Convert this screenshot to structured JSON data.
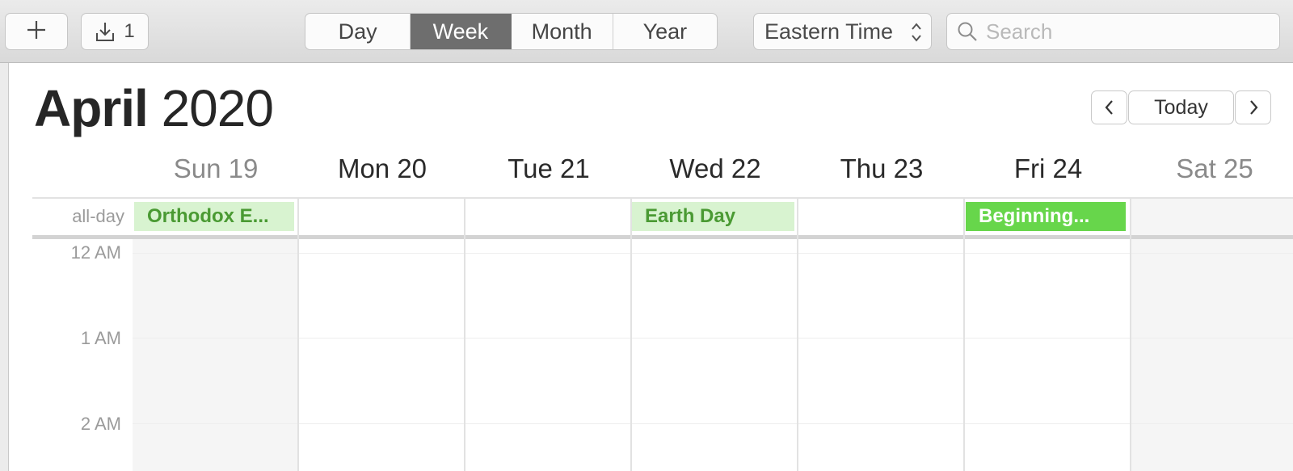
{
  "toolbar": {
    "add_icon": "plus-icon",
    "import_icon": "download-tray-icon",
    "import_count": "1",
    "view_tabs": [
      {
        "label": "Day",
        "active": false
      },
      {
        "label": "Week",
        "active": true
      },
      {
        "label": "Month",
        "active": false
      },
      {
        "label": "Year",
        "active": false
      }
    ],
    "timezone": "Eastern Time",
    "search_placeholder": "Search"
  },
  "header": {
    "month": "April",
    "year": "2020",
    "prev_icon": "chevron-left-icon",
    "today_label": "Today",
    "next_icon": "chevron-right-icon"
  },
  "days": [
    {
      "label": "Sun 19",
      "weekend": true
    },
    {
      "label": "Mon 20",
      "weekend": false
    },
    {
      "label": "Tue 21",
      "weekend": false
    },
    {
      "label": "Wed 22",
      "weekend": false
    },
    {
      "label": "Thu 23",
      "weekend": false
    },
    {
      "label": "Fri 24",
      "weekend": false
    },
    {
      "label": "Sat 25",
      "weekend": true
    }
  ],
  "all_day": {
    "label": "all-day",
    "events": [
      {
        "title": "Orthodox E...",
        "day": "Sun 19",
        "style": "light"
      },
      {
        "title": "Earth Day",
        "day": "Wed 22",
        "style": "light"
      },
      {
        "title": "Beginning...",
        "day": "Fri 24",
        "style": "bold"
      }
    ]
  },
  "hours": [
    "12 AM",
    "1 AM",
    "2 AM"
  ],
  "colors": {
    "active_tab": "#6e6e6e",
    "event_light_bg": "#d8f3d0",
    "event_light_text": "#4a9a33",
    "event_bold_bg": "#67d64b",
    "event_bold_text": "#ffffff",
    "weekend_bg": "#f5f5f5"
  }
}
